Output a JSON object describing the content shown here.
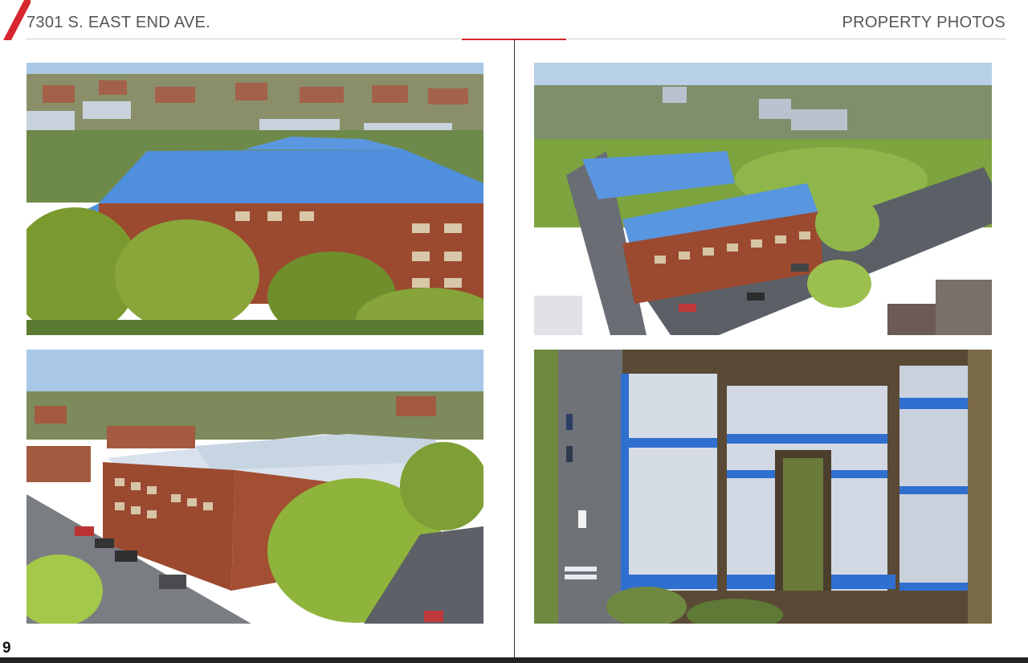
{
  "header": {
    "address": "7301 S. EAST END AVE.",
    "section": "PROPERTY PHOTOS"
  },
  "colors": {
    "accent": "#d7262e",
    "text": "#555555",
    "brick": "#9b4a30",
    "roof": "#3f86e0",
    "foliage": "#6e9a2f",
    "sky": "#a9c8e6"
  },
  "photos": [
    {
      "id": "aerial-view-1"
    },
    {
      "id": "aerial-view-2"
    },
    {
      "id": "aerial-view-3"
    },
    {
      "id": "overhead-view"
    }
  ],
  "footer": {
    "page_number": "9"
  }
}
